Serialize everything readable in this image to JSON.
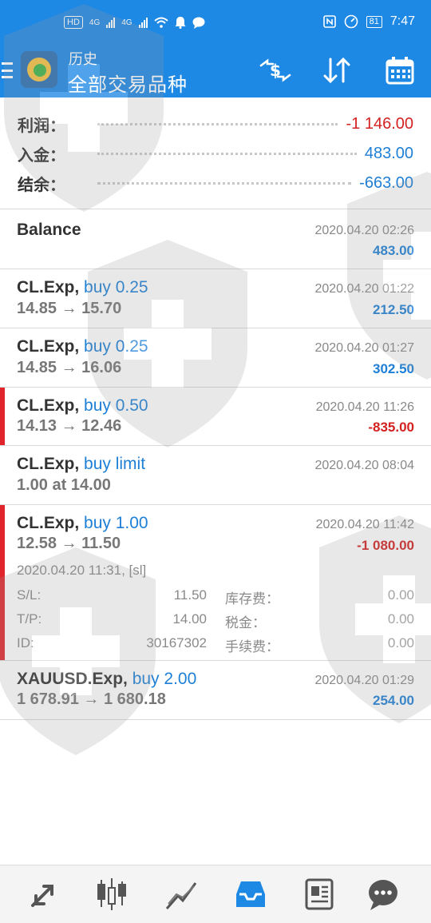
{
  "status_bar": {
    "hd_label": "HD",
    "net_1": "4G",
    "net_2": "4G",
    "battery": "81",
    "time": "7:47"
  },
  "header": {
    "subtitle": "历史",
    "title": "全部交易品种",
    "icons": [
      "menu-icon",
      "metatrader-logo",
      "currency-sort-icon",
      "sort-arrows-icon",
      "calendar-icon"
    ]
  },
  "summary": {
    "profit_label": "利润：",
    "profit_value": "-1 146.00",
    "deposit_label": "入金：",
    "deposit_value": "483.00",
    "balance_label": "结余：",
    "balance_value": "-663.00"
  },
  "deals": [
    {
      "title": "Balance",
      "op": "",
      "prices": "",
      "time": "2020.04.20 02:26",
      "profit": "483.00",
      "negative": false,
      "marker": false
    },
    {
      "title": "CL.Exp,",
      "op": "buy 0.25",
      "prices": "14.85 → 15.70",
      "time": "2020.04.20 01:22",
      "profit": "212.50",
      "negative": false,
      "marker": false
    },
    {
      "title": "CL.Exp,",
      "op": "buy 0.25",
      "prices": "14.85 → 16.06",
      "time": "2020.04.20 01:27",
      "profit": "302.50",
      "negative": false,
      "marker": false
    },
    {
      "title": "CL.Exp,",
      "op": "buy 0.50",
      "prices": "14.13 → 12.46",
      "time": "2020.04.20 11:26",
      "profit": "-835.00",
      "negative": true,
      "marker": true
    },
    {
      "title": "CL.Exp,",
      "op": "buy limit",
      "prices": "1.00 at 14.00",
      "time": "2020.04.20 08:04",
      "profit": "",
      "negative": false,
      "marker": false
    },
    {
      "title": "CL.Exp,",
      "op": "buy 1.00",
      "prices": "12.58 → 11.50",
      "time": "2020.04.20 11:42",
      "profit": "-1 080.00",
      "negative": true,
      "marker": true
    },
    {
      "title": "XAUUSD.Exp,",
      "op": "buy 2.00",
      "prices": "1 678.91 → 1 680.18",
      "time": "2020.04.20 01:29",
      "profit": "254.00",
      "negative": false,
      "marker": false
    }
  ],
  "expanded": {
    "open_time": "2020.04.20 11:31, [sl]",
    "sl_label": "S/L:",
    "sl_value": "11.50",
    "tp_label": "T/P:",
    "tp_value": "14.00",
    "id_label": "ID:",
    "id_value": "30167302",
    "swap_label": "库存费：",
    "swap_value": "0.00",
    "tax_label": "税金：",
    "tax_value": "0.00",
    "fee_label": "手续费：",
    "fee_value": "0.00"
  },
  "bottom_nav": {
    "items": [
      "trade-arrows-icon",
      "candlestick-icon",
      "chart-line-icon",
      "history-inbox-icon",
      "news-icon",
      "chat-icon"
    ],
    "active": "history-inbox-icon",
    "active_color": "#1e88e5",
    "inactive_color": "#555555"
  },
  "colors": {
    "header_bg": "#1e88e5",
    "positive": "#1e7fd6",
    "negative": "#d32121",
    "marker": "#e0262c"
  }
}
